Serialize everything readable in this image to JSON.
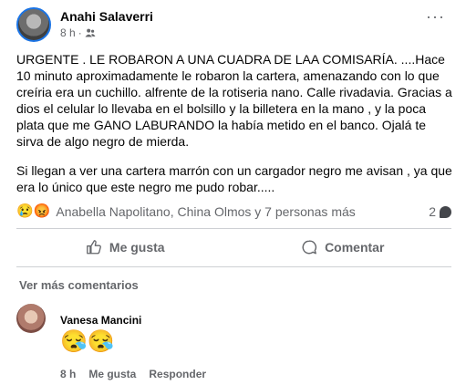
{
  "post": {
    "author": "Anahi Salaverri",
    "time": "8 h",
    "paragraphs": [
      "URGENTE . LE ROBARON A UNA CUADRA DE LAA COMISARÍA.  ....Hace 10 minuto aproximadamente le  robaron la cartera,  amenazando con lo que creíria era un cuchillo.  alfrente de la rotiseria nano. Calle rivadavia. Gracias  a dios  el celular  lo llevaba en el bolsillo y la billetera en la mano , y la poca plata que me GANO LABURANDO la había  metido en el banco. Ojalá te sirva de algo negro de mierda.",
      "Si llegan a ver una cartera marrón  con un cargador negro me avisan , ya que era lo único que este negro me pudo robar....."
    ],
    "reaction_emojis": [
      "😢",
      "😡"
    ],
    "reactions_text": "Anabella Napolitano, China Olmos y 7 personas más",
    "comment_count": "2",
    "like_label": "Me gusta",
    "comment_label": "Comentar",
    "more_comments_label": "Ver más comentarios"
  },
  "comment": {
    "author": "Vanesa Mancini",
    "emoji": "😪😪",
    "time": "8 h",
    "like_label": "Me gusta",
    "reply_label": "Responder"
  }
}
